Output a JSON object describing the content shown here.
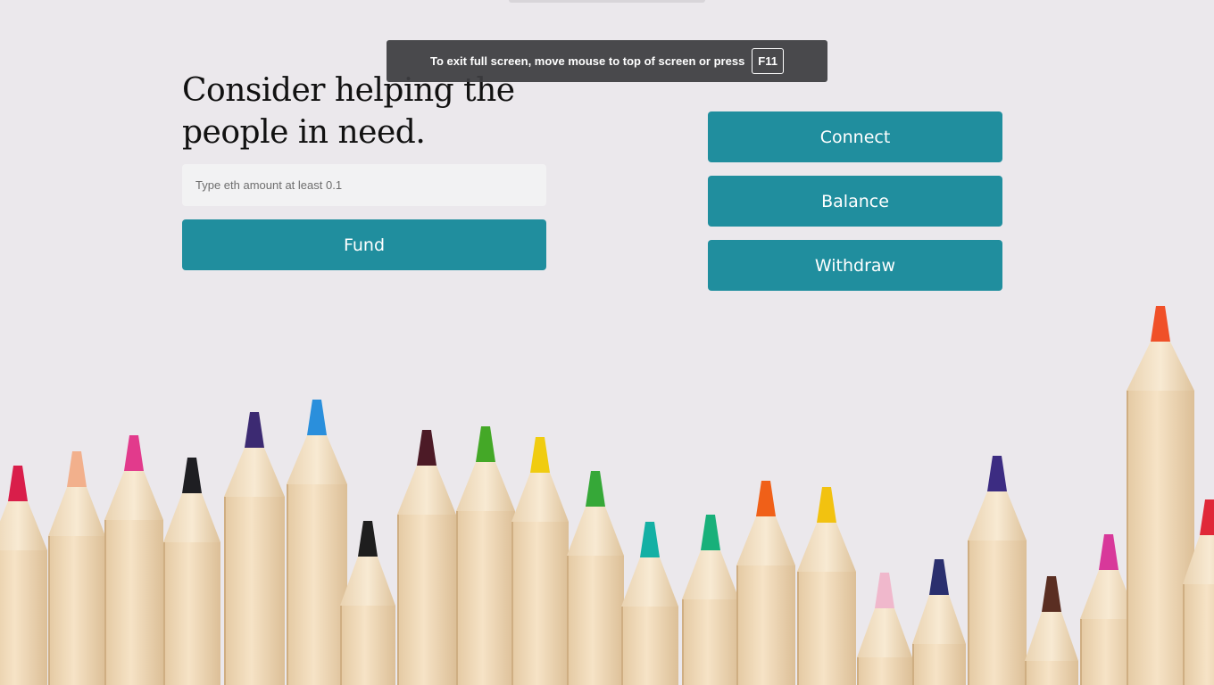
{
  "headline": "Consider helping the people in need.",
  "fund": {
    "input_placeholder": "Type eth amount at least 0.1",
    "input_value": "",
    "button_label": "Fund"
  },
  "actions": {
    "connect_label": "Connect",
    "balance_label": "Balance",
    "withdraw_label": "Withdraw"
  },
  "fullscreen_notice": {
    "text": "To exit full screen, move mouse to top of screen or press",
    "key": "F11"
  },
  "colors": {
    "button": "#208e9e",
    "background": "#ebe8ec"
  },
  "background_image": "colored-pencils",
  "pencil_tip_colors": [
    "#d91e4a",
    "#f2b08c",
    "#e23a8c",
    "#1e1e22",
    "#3c2a72",
    "#2a8fdc",
    "#1e1e1e",
    "#4c1a26",
    "#44a827",
    "#f0cc10",
    "#36a838",
    "#14b0a4",
    "#18b07a",
    "#f06018",
    "#f2c210",
    "#f0b8cc",
    "#2a2f6e",
    "#3c2c82",
    "#5a2e22",
    "#d8389a",
    "#f05028",
    "#e02838",
    "#7a1f2c"
  ]
}
